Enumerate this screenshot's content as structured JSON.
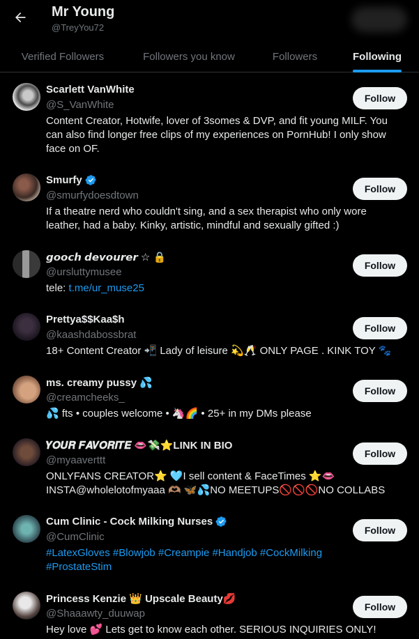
{
  "header": {
    "back_icon": "arrow-left-icon",
    "name": "Mr Young",
    "handle": "@TreyYou72"
  },
  "tabs": [
    {
      "label": "Verified Followers",
      "active": false
    },
    {
      "label": "Followers you know",
      "active": false
    },
    {
      "label": "Followers",
      "active": false
    },
    {
      "label": "Following",
      "active": true
    }
  ],
  "accent_color": "#1d9bf0",
  "users": [
    {
      "name": "Scarlett VanWhite",
      "handle": "@S_VanWhite",
      "verified": false,
      "bio": [
        "Content Creator, Hotwife, lover of 3somes & DVP, and fit young MILF. You",
        "can also find longer free clips of my experiences on PornHub! I only show",
        "face on OF."
      ],
      "follow_label": "Follow"
    },
    {
      "name": "Smurfy",
      "handle": "@smurfydoesdtown",
      "verified": true,
      "bio": [
        "If a theatre nerd who couldn't sing, and a sex therapist who only wore",
        "leather, had a baby. Kinky, artistic, mindful and sexually gifted :)"
      ],
      "follow_label": "Follow"
    },
    {
      "name": "𝙜𝙤𝙤𝙘𝙝 𝙙𝙚𝙫𝙤𝙪𝙧𝙚𝙧 ☆ 🔒",
      "handle": "@ursluttymusee",
      "verified": false,
      "bio_prefix": "tele: ",
      "bio_link": "t.me/ur_muse25",
      "follow_label": "Follow"
    },
    {
      "name": "Prettya$$Kaa$h",
      "handle": "@kaashdabossbrat",
      "verified": false,
      "bio": [
        "18+ Content Creator 📲 Lady of leisure 💫🥂 ONLY PAGE . KINK TOY 🐾"
      ],
      "follow_label": "Follow"
    },
    {
      "name": "ms. creamy pussy 💦",
      "handle": "@creamcheeks_",
      "verified": false,
      "bio": [
        "💦 fts • couples welcome • 🦄🌈 • 25+ in my DMs please"
      ],
      "follow_label": "Follow"
    },
    {
      "name": "𝒀𝑶𝑼𝑹 𝑭𝑨𝑽𝑶𝑹𝑰𝑻𝑬 👄💸⭐LINK IN BIO",
      "handle": "@myaaverttt",
      "verified": false,
      "bio": [
        "ONLYFANS CREATOR⭐ 🩵I sell content & FaceTimes ⭐👄",
        "INSTA@wholelotofmyaaa 🫶🏽 🦋💦NO MEETUPS🚫🚫🚫NO COLLABS"
      ],
      "follow_label": "Follow"
    },
    {
      "name": "Cum Clinic - Cock Milking Nurses",
      "handle": "@CumClinic",
      "verified": true,
      "bio_links": [
        "#LatexGloves #Blowjob #Creampie #Handjob #CockMilking",
        "#ProstateStim"
      ],
      "follow_label": "Follow"
    },
    {
      "name": "Princess Kenzie 👑 Upscale Beauty💋",
      "handle": "@Shaaawty_duuwap",
      "verified": false,
      "bio": [
        "Hey love 💕 Lets get to know each other. SERIOUS INQUIRIES ONLY!"
      ],
      "follow_label": "Follow"
    }
  ]
}
